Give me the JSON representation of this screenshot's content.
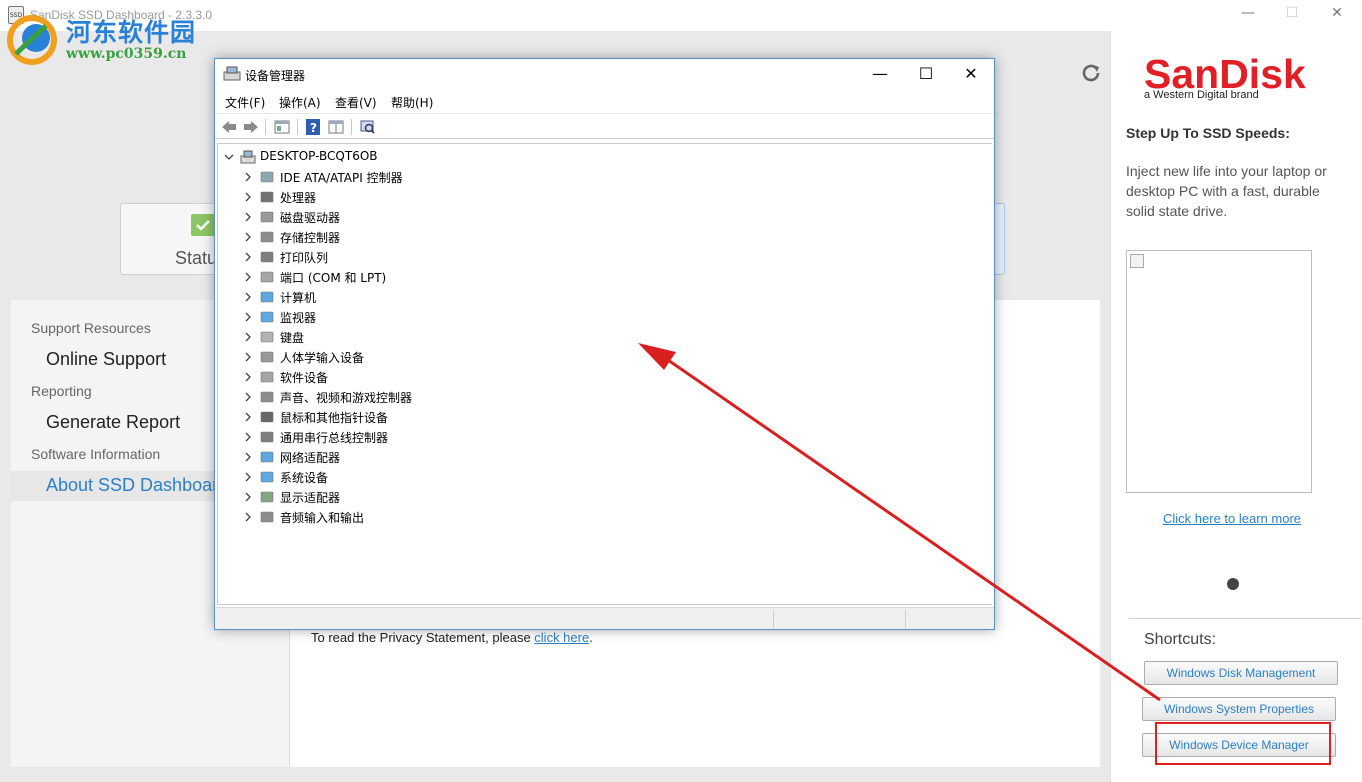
{
  "app": {
    "title": "SanDisk SSD Dashboard - 2.3.3.0",
    "title_icon_text": "SSD",
    "window_controls": {
      "minimize": "—",
      "maximize": "☐",
      "close": "✕"
    },
    "status_tab_label": "Status",
    "left_panel": {
      "support_header": "Support Resources",
      "online_support": "Online Support",
      "reporting_header": "Reporting",
      "generate_report": "Generate Report",
      "software_header": "Software Information",
      "about": "About SSD Dashboard"
    },
    "privacy": {
      "text": "To read the Privacy Statement, please ",
      "link": "click here",
      "suffix": "."
    }
  },
  "side": {
    "brand": "SanDisk",
    "brand_sub": "a Western Digital brand",
    "heading": "Step Up To SSD Speeds:",
    "description": "Inject new life into your laptop or desktop PC with a fast, durable solid state drive.",
    "learn_more": "Click here to learn more",
    "shortcuts_title": "Shortcuts:",
    "shortcuts": [
      "Windows Disk Management",
      "Windows System Properties",
      "Windows Device Manager"
    ]
  },
  "watermark": {
    "title": "河东软件园",
    "url": "www.pc0359.cn"
  },
  "device_manager": {
    "title": "设备管理器",
    "window_controls": {
      "minimize": "—",
      "maximize": "☐",
      "close": "✕"
    },
    "menu": [
      "文件(F)",
      "操作(A)",
      "查看(V)",
      "帮助(H)"
    ],
    "root": "DESKTOP-BCQT6OB",
    "categories": [
      {
        "label": "IDE ATA/ATAPI 控制器",
        "icon": "ide-controller-icon"
      },
      {
        "label": "处理器",
        "icon": "processor-icon"
      },
      {
        "label": "磁盘驱动器",
        "icon": "disk-drive-icon"
      },
      {
        "label": "存储控制器",
        "icon": "storage-controller-icon"
      },
      {
        "label": "打印队列",
        "icon": "printer-icon"
      },
      {
        "label": "端口 (COM 和 LPT)",
        "icon": "port-icon"
      },
      {
        "label": "计算机",
        "icon": "computer-icon"
      },
      {
        "label": "监视器",
        "icon": "monitor-icon"
      },
      {
        "label": "键盘",
        "icon": "keyboard-icon"
      },
      {
        "label": "人体学输入设备",
        "icon": "hid-icon"
      },
      {
        "label": "软件设备",
        "icon": "software-device-icon"
      },
      {
        "label": "声音、视频和游戏控制器",
        "icon": "sound-icon"
      },
      {
        "label": "鼠标和其他指针设备",
        "icon": "mouse-icon"
      },
      {
        "label": "通用串行总线控制器",
        "icon": "usb-icon"
      },
      {
        "label": "网络适配器",
        "icon": "network-adapter-icon"
      },
      {
        "label": "系统设备",
        "icon": "system-device-icon"
      },
      {
        "label": "显示适配器",
        "icon": "display-adapter-icon"
      },
      {
        "label": "音频输入和输出",
        "icon": "audio-io-icon"
      }
    ]
  },
  "colors": {
    "accent_blue": "#2a7fc9",
    "sandisk_red": "#e01f26",
    "annotation_red": "#e02020"
  }
}
